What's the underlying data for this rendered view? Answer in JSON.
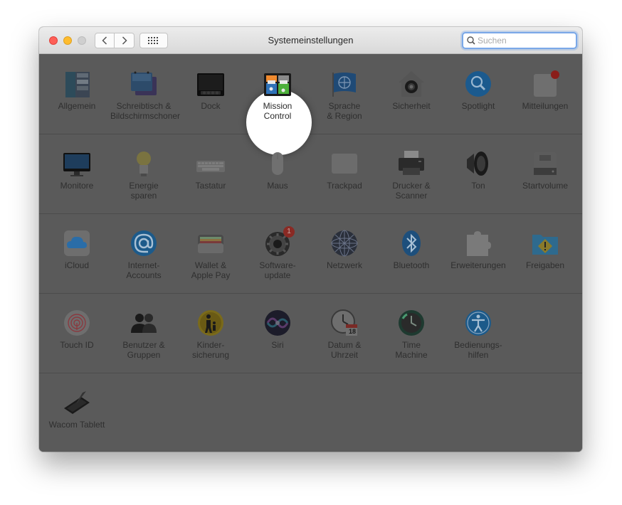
{
  "window": {
    "title": "Systemeinstellungen"
  },
  "search": {
    "placeholder": "Suchen"
  },
  "colors": {
    "highlight": "#ffffff",
    "dim_overlay": "#5a5a5a",
    "badge": "#e0443e",
    "search_focus": "#7aa8e8"
  },
  "rows": [
    [
      {
        "id": "allgemein",
        "label": "Allgemein",
        "icon": "general-icon"
      },
      {
        "id": "schreibtisch",
        "label": "Schreibtisch &\nBildschirmschoner",
        "icon": "desktop-screensaver-icon"
      },
      {
        "id": "dock",
        "label": "Dock",
        "icon": "dock-icon"
      },
      {
        "id": "mission-control",
        "label": "Mission\nControl",
        "icon": "mission-control-icon",
        "highlighted": true
      },
      {
        "id": "sprache",
        "label": "Sprache\n& Region",
        "icon": "language-region-icon"
      },
      {
        "id": "sicherheit",
        "label": "Sicherheit",
        "icon": "security-house-icon"
      },
      {
        "id": "spotlight",
        "label": "Spotlight",
        "icon": "spotlight-magnifier-icon"
      },
      {
        "id": "mitteilungen",
        "label": "Mitteilungen",
        "icon": "notifications-icon"
      }
    ],
    [
      {
        "id": "monitore",
        "label": "Monitore",
        "icon": "display-icon"
      },
      {
        "id": "energie",
        "label": "Energie\nsparen",
        "icon": "lightbulb-icon"
      },
      {
        "id": "tastatur",
        "label": "Tastatur",
        "icon": "keyboard-icon"
      },
      {
        "id": "maus",
        "label": "Maus",
        "icon": "mouse-icon"
      },
      {
        "id": "trackpad",
        "label": "Trackpad",
        "icon": "trackpad-icon"
      },
      {
        "id": "drucker",
        "label": "Drucker &\nScanner",
        "icon": "printer-icon"
      },
      {
        "id": "ton",
        "label": "Ton",
        "icon": "speaker-icon"
      },
      {
        "id": "startvolume",
        "label": "Startvolume",
        "icon": "hard-drive-icon"
      }
    ],
    [
      {
        "id": "icloud",
        "label": "iCloud",
        "icon": "icloud-icon"
      },
      {
        "id": "internet-accounts",
        "label": "Internet-\nAccounts",
        "icon": "at-sign-icon"
      },
      {
        "id": "wallet",
        "label": "Wallet &\nApple Pay",
        "icon": "wallet-icon"
      },
      {
        "id": "softwareupdate",
        "label": "Software-\nupdate",
        "icon": "gear-update-icon",
        "badge": "1"
      },
      {
        "id": "netzwerk",
        "label": "Netzwerk",
        "icon": "network-globe-icon"
      },
      {
        "id": "bluetooth",
        "label": "Bluetooth",
        "icon": "bluetooth-icon"
      },
      {
        "id": "erweiterungen",
        "label": "Erweiterungen",
        "icon": "puzzle-piece-icon"
      },
      {
        "id": "freigaben",
        "label": "Freigaben",
        "icon": "sharing-folder-icon"
      }
    ],
    [
      {
        "id": "touch-id",
        "label": "Touch ID",
        "icon": "fingerprint-icon"
      },
      {
        "id": "benutzer",
        "label": "Benutzer &\nGruppen",
        "icon": "users-icon"
      },
      {
        "id": "kindersicherung",
        "label": "Kinder-\nsicherung",
        "icon": "parental-controls-icon"
      },
      {
        "id": "siri",
        "label": "Siri",
        "icon": "siri-icon"
      },
      {
        "id": "datum",
        "label": "Datum &\nUhrzeit",
        "icon": "clock-calendar-icon",
        "calendar_day": "18"
      },
      {
        "id": "time-machine",
        "label": "Time\nMachine",
        "icon": "time-machine-icon"
      },
      {
        "id": "bedienungshilfen",
        "label": "Bedienungs-\nhilfen",
        "icon": "accessibility-icon"
      }
    ],
    [
      {
        "id": "wacom",
        "label": "Wacom Tablett",
        "icon": "wacom-tablet-icon"
      }
    ]
  ]
}
